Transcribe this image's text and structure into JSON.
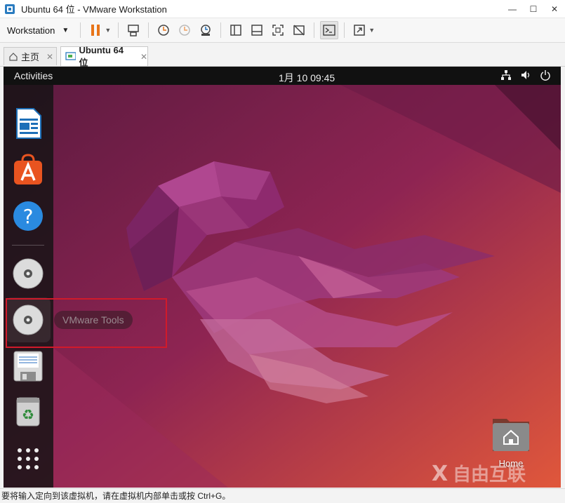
{
  "window": {
    "title": "Ubuntu 64 位 - VMware Workstation",
    "controls": [
      "minimize-icon",
      "maximize-icon",
      "close-icon"
    ]
  },
  "toolbar": {
    "workstation_label": "Workstation",
    "icons": [
      "pause-icon",
      "send-ctrl-alt-del-icon",
      "snapshot-take-icon",
      "snapshot-revert-icon",
      "snapshot-manager-icon",
      "library-icon",
      "thumbnail-bar-icon",
      "full-screen-icon",
      "unity-icon",
      "console-view-icon",
      "stretch-icon"
    ],
    "accent": "#e8751a"
  },
  "tabs": [
    {
      "label": "主页",
      "icon": "home-icon"
    },
    {
      "label": "Ubuntu 64 位",
      "icon": "vm-icon",
      "active": true
    }
  ],
  "vm": {
    "activities": "Activities",
    "clock": "1月 10  09:45",
    "tray_icons": [
      "network-icon",
      "volume-icon",
      "power-icon"
    ],
    "dock": [
      {
        "name": "libreoffice-writer-icon"
      },
      {
        "name": "app-center-icon"
      },
      {
        "name": "help-icon"
      },
      {
        "name": "cd-drive-icon"
      },
      {
        "name": "vmware-tools-cd-icon"
      },
      {
        "name": "floppy-drive-icon"
      },
      {
        "name": "trash-icon"
      },
      {
        "name": "show-apps-icon"
      }
    ],
    "tooltip": "VMware Tools",
    "desktop_home_label": "Home",
    "wallpaper_colors": [
      "#5a1a3f",
      "#a82c5b",
      "#e0573b"
    ]
  },
  "watermark": "自由互联",
  "status": "要将输入定向到该虚拟机，请在虚拟机内部单击或按 Ctrl+G。",
  "highlight_color": "#d11a2a"
}
